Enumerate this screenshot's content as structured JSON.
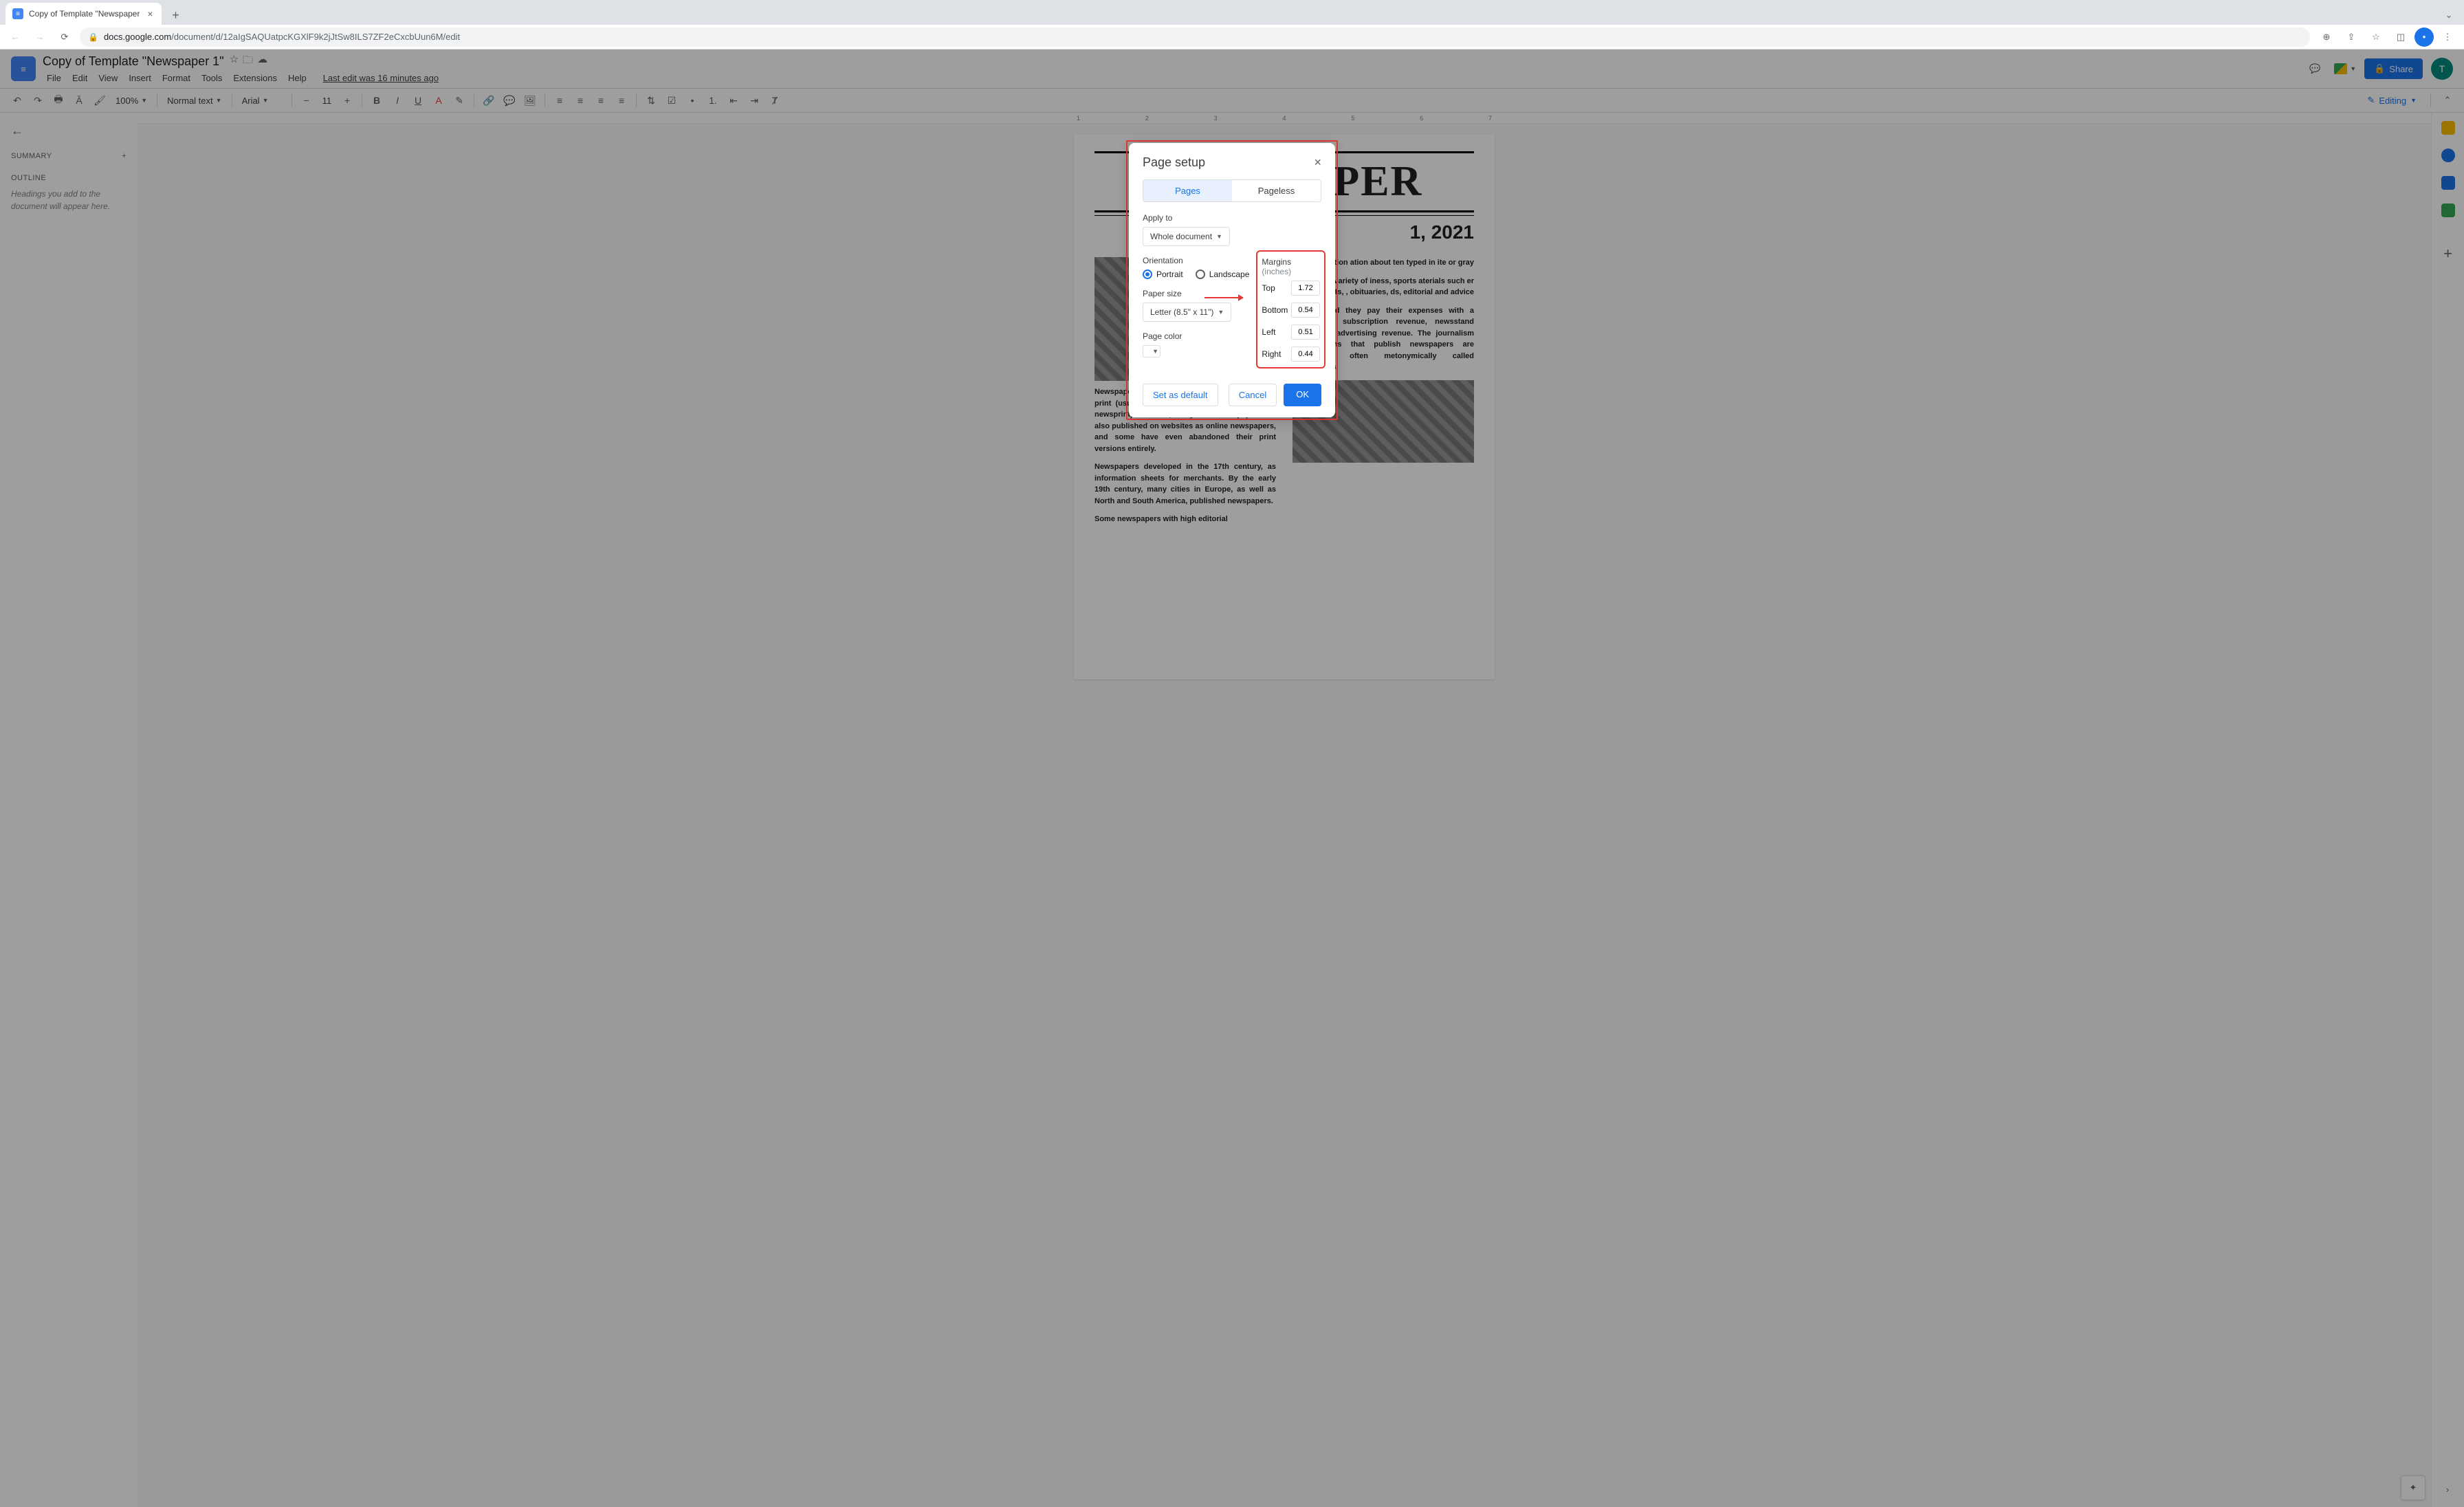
{
  "browser": {
    "tab_title": "Copy of Template \"Newspaper",
    "url_domain": "docs.google.com",
    "url_path": "/document/d/12aIgSAQUatpcKGXlF9k2jJtSw8ILS7ZF2eCxcbUun6M/edit"
  },
  "header": {
    "doc_title": "Copy of Template \"Newspaper 1\"",
    "menus": [
      "File",
      "Edit",
      "View",
      "Insert",
      "Format",
      "Tools",
      "Extensions",
      "Help"
    ],
    "last_edit": "Last edit was 16 minutes ago",
    "share": "Share",
    "avatar_letter": "T"
  },
  "toolbar": {
    "zoom": "100%",
    "style": "Normal text",
    "font": "Arial",
    "font_size": "11",
    "mode": "Editing"
  },
  "outline": {
    "summary": "SUMMARY",
    "outline": "OUTLINE",
    "hint": "Headings you add to the document will appear here."
  },
  "ruler_marks": [
    "1",
    "2",
    "3",
    "4",
    "5",
    "6",
    "7"
  ],
  "newspaper": {
    "title": "NEWSPAPER",
    "date": "1, 2021",
    "col1_p1": "Newspapers have traditionally been published in print (usually on cheap, low-grade paper called newsprint). However, today most newspapers are also published on websites as online newspapers, and some have even abandoned their print versions entirely.",
    "col1_p2": "Newspapers developed in the 17th century, as information sheets for merchants. By the early 19th century, many cities in Europe, as well as North and South America, published newspapers.",
    "col1_p3": "Some newspapers with high editorial",
    "col2_p1": "al publication ation about ten typed in ite or gray",
    "col2_p2": "ide variety of iness, sports aterials such er forecasts, , obituaries, ds, editorial and advice",
    "col2_p3": "nesses, and they pay their expenses with a mixture of subscription revenue, newsstand sales, and advertising revenue. The journalism organizations that publish newspapers are themselves often metonymically called newspapers."
  },
  "dialog": {
    "title": "Page setup",
    "tabs": {
      "pages": "Pages",
      "pageless": "Pageless"
    },
    "apply_to_label": "Apply to",
    "apply_to_value": "Whole document",
    "orientation_label": "Orientation",
    "portrait": "Portrait",
    "landscape": "Landscape",
    "paper_size_label": "Paper size",
    "paper_size_value": "Letter (8.5\" x 11\")",
    "page_color_label": "Page color",
    "margins_label": "Margins",
    "margins_unit": "(inches)",
    "margins": {
      "top_label": "Top",
      "top": "1.72",
      "bottom_label": "Bottom",
      "bottom": "0.54",
      "left_label": "Left",
      "left": "0.51",
      "right_label": "Right",
      "right": "0.44"
    },
    "set_default": "Set as default",
    "cancel": "Cancel",
    "ok": "OK"
  }
}
